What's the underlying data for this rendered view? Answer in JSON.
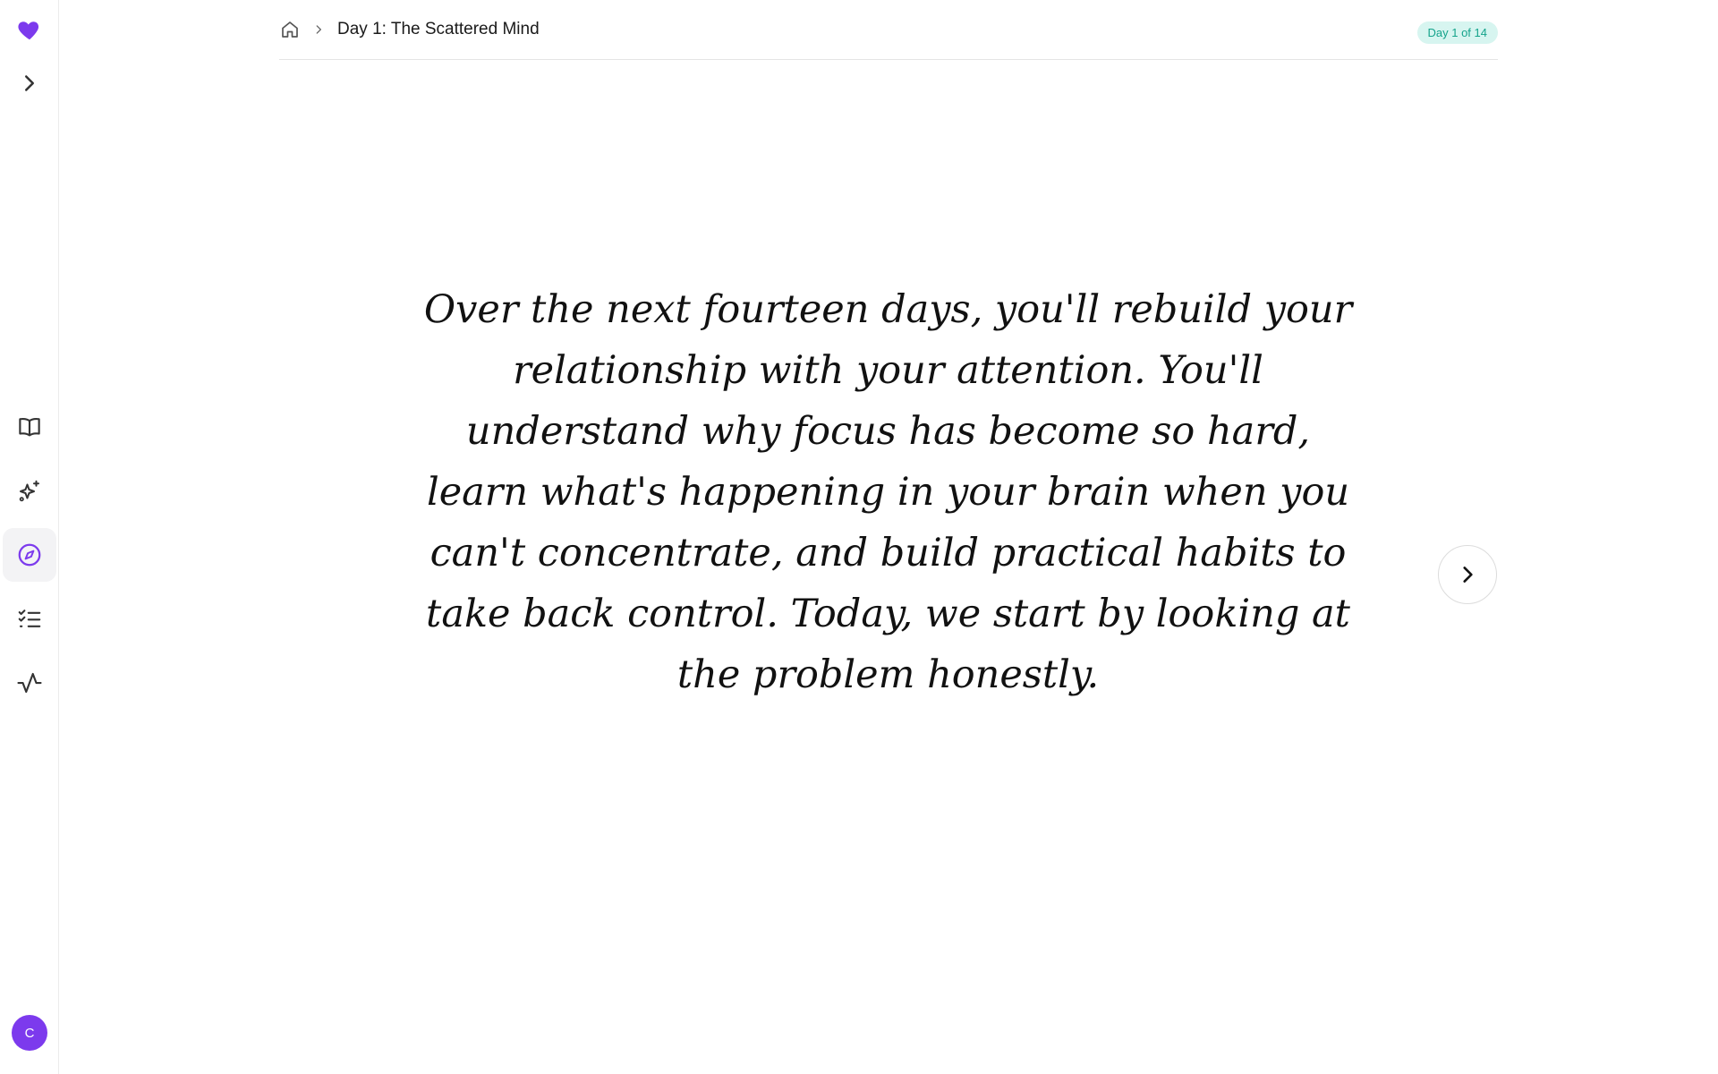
{
  "sidebar": {
    "logo_icon": "heart-icon",
    "expand_icon": "chevron-right-icon",
    "nav": [
      {
        "name": "learn",
        "icon": "open-book-icon"
      },
      {
        "name": "sparkle",
        "icon": "sparkle-icon"
      },
      {
        "name": "explore",
        "icon": "compass-icon",
        "active": true
      },
      {
        "name": "tasks",
        "icon": "checklist-icon"
      },
      {
        "name": "activity",
        "icon": "activity-icon"
      }
    ],
    "avatar_initial": "C",
    "accent": "#7c3aed"
  },
  "header": {
    "home_icon": "home-icon",
    "breadcrumb_current": "Day 1: The Scattered Mind",
    "progress_badge": "Day 1 of 14",
    "badge_color": "#14a38b"
  },
  "main": {
    "quote": "Over the next fourteen days, you'll rebuild your relationship with your attention. You'll understand why focus has become so hard, learn what's happening in your brain when you can't concentrate, and build practical habits to take back control. Today, we start by looking at the problem honestly.",
    "next_icon": "chevron-right-icon"
  }
}
